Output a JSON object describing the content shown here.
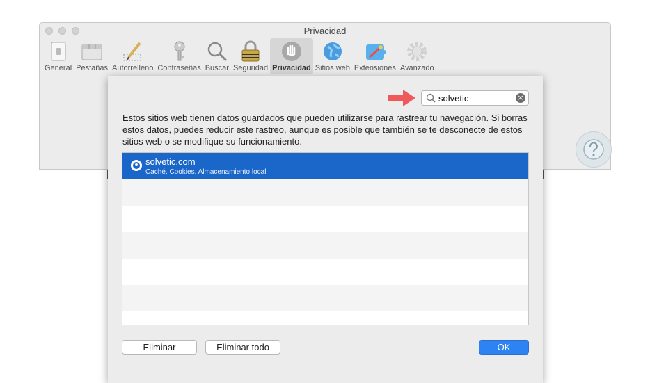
{
  "window": {
    "title": "Privacidad"
  },
  "toolbar": {
    "items": [
      {
        "label": "General",
        "icon": "general-switch-icon"
      },
      {
        "label": "Pestañas",
        "icon": "tabs-icon"
      },
      {
        "label": "Autorrelleno",
        "icon": "pencil-icon"
      },
      {
        "label": "Contraseñas",
        "icon": "key-icon"
      },
      {
        "label": "Buscar",
        "icon": "magnifier-icon"
      },
      {
        "label": "Seguridad",
        "icon": "padlock-icon"
      },
      {
        "label": "Privacidad",
        "icon": "hand-icon",
        "active": true
      },
      {
        "label": "Sitios web",
        "icon": "globe-icon"
      },
      {
        "label": "Extensiones",
        "icon": "puzzle-icon"
      },
      {
        "label": "Avanzado",
        "icon": "gear-icon"
      }
    ]
  },
  "sheet": {
    "search": {
      "value": "solvetic",
      "clear_glyph": "×"
    },
    "description": "Estos sitios web tienen datos guardados que pueden utilizarse para rastrear tu navegación. Si borras estos datos, puedes reducir este rastreo, aunque es posible que también se te desconecte de estos sitios web o se modifique su funcionamiento.",
    "sites": [
      {
        "domain": "solvetic.com",
        "detail": "Caché, Cookies, Almacenamiento local",
        "selected": true
      }
    ],
    "buttons": {
      "remove": "Eliminar",
      "remove_all": "Eliminar todo",
      "ok": "OK"
    }
  },
  "colors": {
    "selection": "#1b67c9",
    "primary_button": "#2d83f2",
    "annotation_arrow": "#f0595c"
  }
}
